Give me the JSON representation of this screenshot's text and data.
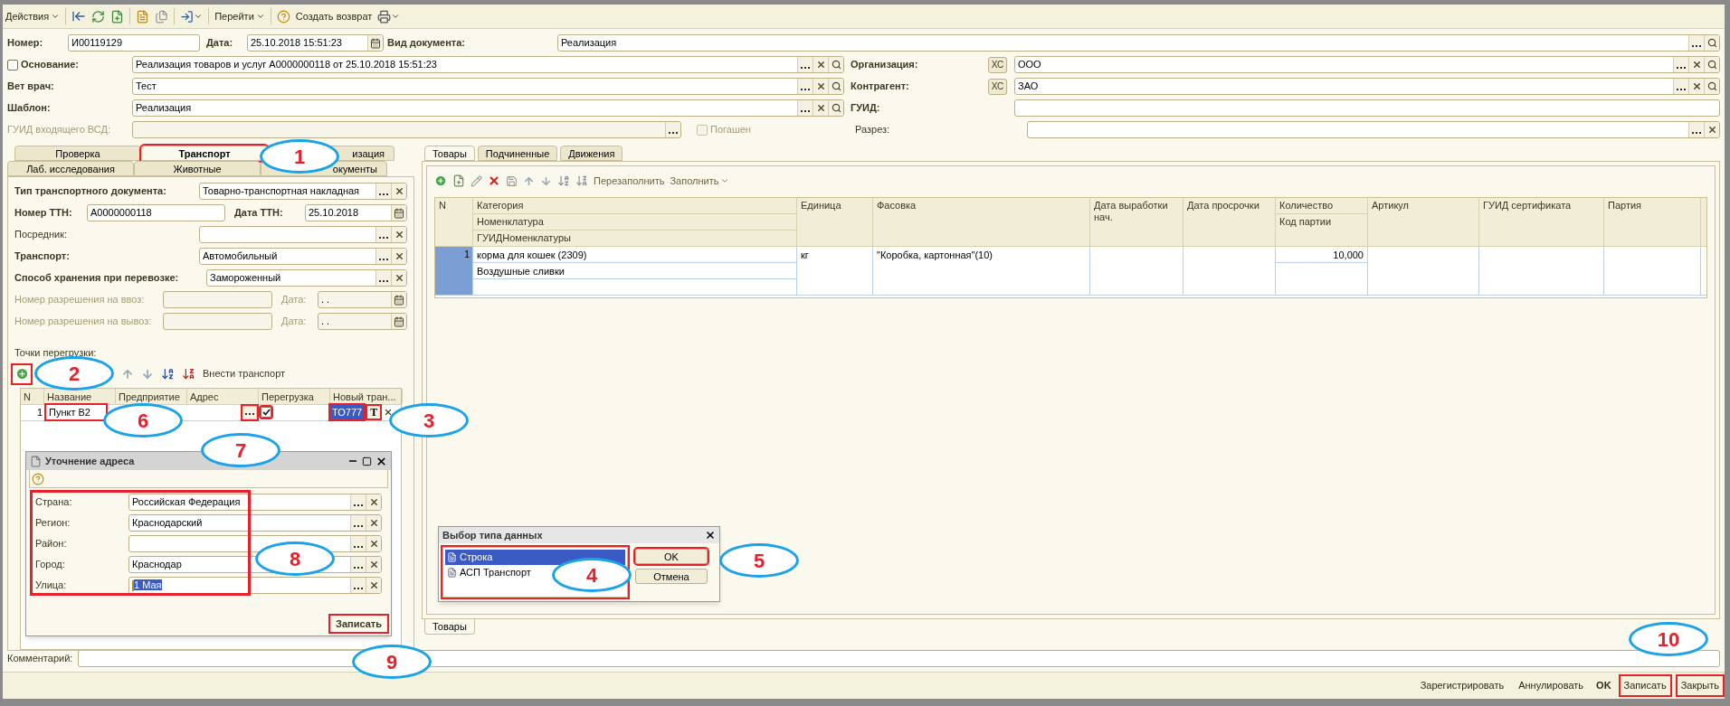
{
  "toolbar": {
    "actions_menu": "Действия",
    "goto_menu": "Перейти",
    "create_return": "Создать возврат"
  },
  "header": {
    "number": {
      "label": "Номер:",
      "value": "И00119129"
    },
    "date": {
      "label": "Дата:",
      "value": "25.10.2018 15:51:23"
    },
    "doc_type": {
      "label": "Вид документа:",
      "value": "Реализация"
    },
    "basis": {
      "label": "Основание:",
      "checked": false,
      "value": "Реализация товаров и услуг А0000000118 от 25.10.2018 15:51:23"
    },
    "organization": {
      "label": "Организация:",
      "xc": "ХС",
      "value": "ООО"
    },
    "vet": {
      "label": "Вет врач:",
      "value": "Тест"
    },
    "contractor": {
      "label": "Контрагент:",
      "xc": "ХС",
      "value": "ЗАО"
    },
    "template": {
      "label": "Шаблон:",
      "value": "Реализация"
    },
    "guid": {
      "label": "ГУИД:"
    },
    "vsd_guid": {
      "label": "ГУИД входящего ВСД:",
      "disabled": true
    },
    "repaid": {
      "label": "Погашен",
      "checked": false,
      "disabled": true
    },
    "section": {
      "label": "Разрез:"
    }
  },
  "left_tabs": [
    [
      {
        "label": "Проверка",
        "selected": false,
        "marked": false
      },
      {
        "label": "Транспорт",
        "selected": true,
        "marked": true
      },
      {
        "label": "изация",
        "selected": false,
        "marked": false
      }
    ],
    [
      {
        "label": "Лаб. исследования",
        "selected": false,
        "marked": false
      },
      {
        "label": "Животные",
        "selected": false,
        "marked": false
      },
      {
        "label": "окументы",
        "selected": false,
        "marked": false
      }
    ]
  ],
  "transport": {
    "doc_type": {
      "label": "Тип транспортного документа:",
      "value": "Товарно-транспортная накладная"
    },
    "ttn_number": {
      "label": "Номер ТТН:",
      "value": "А0000000118"
    },
    "ttn_date": {
      "label": "Дата ТТН:",
      "value": "25.10.2018"
    },
    "intermediary": {
      "label": "Посредник:"
    },
    "vehicle": {
      "label": "Транспорт:",
      "value": "Автомобильный"
    },
    "storage": {
      "label": "Способ хранения при перевозке:",
      "value": "Замороженный"
    },
    "permits": [
      {
        "label": "Номер разрешения на ввоз:",
        "date_label": "Дата:",
        "date_value": ". .",
        "disabled": true
      },
      {
        "label": "Номер разрешения на вывоз:",
        "date_label": "Дата:",
        "date_value": ". .",
        "disabled": true
      }
    ]
  },
  "points": {
    "title": "Точки перегрузки:",
    "add_marked": true,
    "action": "Внести транспорт",
    "columns": [
      "N",
      "Название",
      "Предприятие",
      "Адрес",
      "Перегрузка",
      "Новый тран..."
    ],
    "rows": [
      {
        "n": "1",
        "name": "Пункт В2",
        "name_marked": true,
        "address_button_marked": true,
        "reload": true,
        "reload_marked": true,
        "new_transport": "ТО777",
        "new_transport_marked": true,
        "type_button": "T",
        "type_button_marked": true
      }
    ]
  },
  "address_dialog": {
    "title": "Уточнение адреса",
    "fields_marked": true,
    "fields": [
      {
        "label": "Страна:",
        "value": "Российская Федерация",
        "selected": false
      },
      {
        "label": "Регион:",
        "value": "Краснодарский",
        "selected": false
      },
      {
        "label": "Район:",
        "selected": false
      },
      {
        "label": "Город:",
        "value": "Краснодар",
        "selected": false
      },
      {
        "label": "Улица:",
        "value": "1 Мая",
        "selected": true
      }
    ],
    "save": {
      "label": "Записать",
      "marked": true
    }
  },
  "right_tabs": [
    {
      "label": "Товары",
      "selected": true
    },
    {
      "label": "Подчиненные",
      "selected": false
    },
    {
      "label": "Движения",
      "selected": false
    }
  ],
  "goods_toolbar": {
    "refill": "Перезаполнить",
    "fill": "Заполнить"
  },
  "goods_table": {
    "columns": [
      {
        "title": "N"
      },
      {
        "title": "Категория",
        "subtitles": [
          "Номенклатура",
          "ГУИДНоменклатуры"
        ]
      },
      {
        "title": "Единица"
      },
      {
        "title": "Фасовка"
      },
      {
        "title": "Дата выработки нач."
      },
      {
        "title": "Дата просрочки"
      },
      {
        "title": "Количество",
        "subtitles": [
          "Код партии"
        ]
      },
      {
        "title": "Артикул"
      },
      {
        "title": "ГУИД сертификата"
      },
      {
        "title": "Партия"
      }
    ],
    "rows": [
      {
        "selected": true,
        "cells": [
          [
            "1"
          ],
          [
            "корма для кошек (2309)",
            "Воздушные сливки",
            ""
          ],
          [
            "кг"
          ],
          [
            "\"Коробка, картонная\"(10)"
          ],
          [
            ""
          ],
          [
            ""
          ],
          [
            "10,000",
            ""
          ],
          [
            ""
          ],
          [
            ""
          ],
          [
            ""
          ]
        ]
      }
    ]
  },
  "type_dialog": {
    "title": "Выбор типа данных",
    "list_marked": true,
    "options": [
      {
        "label": "Строка",
        "selected": true
      },
      {
        "label": "АСП Транспорт",
        "selected": false
      }
    ],
    "ok": {
      "label": "OK",
      "marked": true
    },
    "cancel": "Отмена"
  },
  "bottom_tabs": [
    {
      "label": "Товары",
      "selected": true
    }
  ],
  "comment": {
    "label": "Комментарий:"
  },
  "footer": [
    {
      "label": "Зарегистрировать",
      "kind": "link",
      "marked": false
    },
    {
      "label": "Аннулировать",
      "kind": "link",
      "marked": false
    },
    {
      "label": "OK",
      "kind": "bold",
      "marked": false
    },
    {
      "label": "Записать",
      "kind": "link",
      "marked": true
    },
    {
      "label": "Закрыть",
      "kind": "link",
      "marked": true
    }
  ],
  "callouts": [
    "1",
    "2",
    "3",
    "4",
    "5",
    "6",
    "7",
    "8",
    "9",
    "10"
  ]
}
